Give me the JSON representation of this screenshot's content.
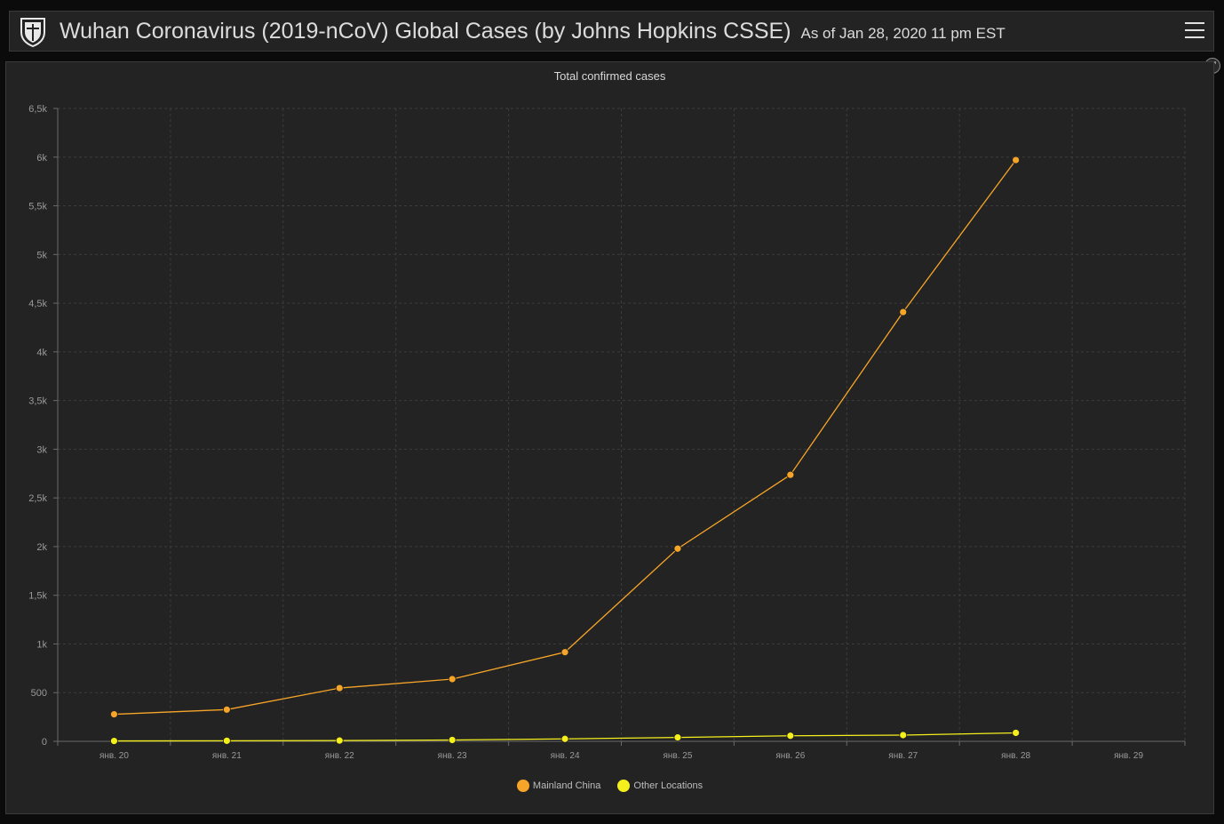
{
  "header": {
    "title": "Wuhan Coronavirus (2019-nCoV) Global Cases (by Johns Hopkins CSSE)",
    "as_of": "As of Jan 28, 2020 11 pm EST",
    "logo_icon": "university-shield-icon",
    "menu_icon": "hamburger-menu-icon"
  },
  "panel": {
    "expand_icon": "expand-icon"
  },
  "colors": {
    "mainland": "#f7a528",
    "other": "#f5f01c",
    "grid": "#3c3c3c",
    "axis": "#6a6a6a",
    "tick_text": "#9a9a9a"
  },
  "chart_data": {
    "type": "line",
    "title": "Total confirmed cases",
    "xlabel": "",
    "ylabel": "",
    "categories": [
      "янв. 20",
      "янв. 21",
      "янв. 22",
      "янв. 23",
      "янв. 24",
      "янв. 25",
      "янв. 26",
      "янв. 27",
      "янв. 28",
      "янв. 29"
    ],
    "series": [
      {
        "name": "Mainland China",
        "values": [
          278,
          326,
          547,
          639,
          916,
          1979,
          2737,
          4409,
          5970,
          null
        ]
      },
      {
        "name": "Other Locations",
        "values": [
          4,
          6,
          8,
          14,
          25,
          40,
          57,
          64,
          87,
          null
        ]
      }
    ],
    "ylim": [
      0,
      6500
    ],
    "yticks": [
      0,
      500,
      1000,
      1500,
      2000,
      2500,
      3000,
      3500,
      4000,
      4500,
      5000,
      5500,
      6000,
      6500
    ],
    "ytick_labels": [
      "0",
      "500",
      "1k",
      "1,5k",
      "2k",
      "2,5k",
      "3k",
      "3,5k",
      "4k",
      "4,5k",
      "5k",
      "5,5k",
      "6k",
      "6,5k"
    ],
    "grid": true,
    "legend_position": "bottom"
  }
}
